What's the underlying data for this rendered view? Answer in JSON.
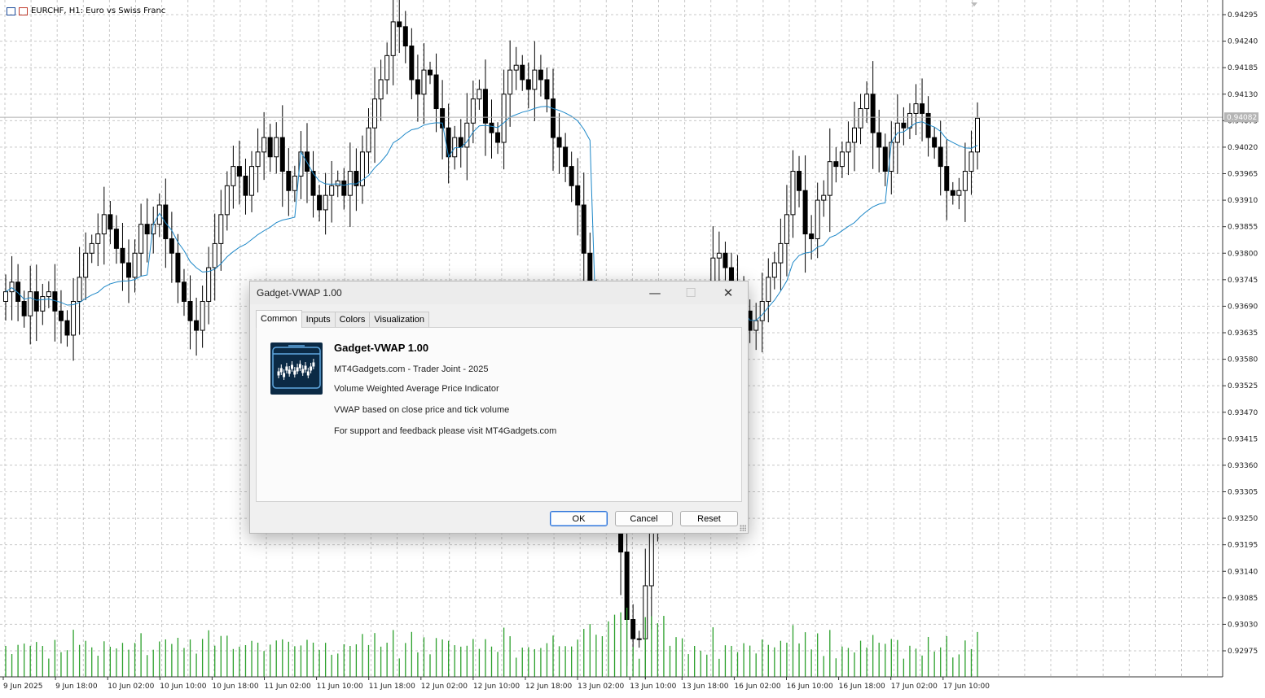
{
  "chart": {
    "symbol_title": "EURCHF, H1:  Euro vs Swiss Franc",
    "current_price": "0.94082",
    "price_ticks": [
      "0.94295",
      "0.94240",
      "0.94185",
      "0.94130",
      "0.94075",
      "0.94020",
      "0.93965",
      "0.93910",
      "0.93855",
      "0.93800",
      "0.93745",
      "0.93690",
      "0.93635",
      "0.93580",
      "0.93525",
      "0.93470",
      "0.93415",
      "0.93360",
      "0.93305",
      "0.93250",
      "0.93195",
      "0.93140",
      "0.93085",
      "0.93030",
      "0.92975"
    ],
    "time_ticks": [
      "9 Jun 2025",
      "9 Jun 18:00",
      "10 Jun 02:00",
      "10 Jun 10:00",
      "10 Jun 18:00",
      "11 Jun 02:00",
      "11 Jun 10:00",
      "11 Jun 18:00",
      "12 Jun 02:00",
      "12 Jun 10:00",
      "12 Jun 18:00",
      "13 Jun 02:00",
      "13 Jun 10:00",
      "13 Jun 18:00",
      "16 Jun 02:00",
      "16 Jun 10:00",
      "16 Jun 18:00",
      "17 Jun 02:00",
      "17 Jun 10:00"
    ],
    "colors": {
      "grid": "#c8c8c8",
      "vwap": "#1e88c8",
      "volume": "#2ca02c",
      "candle": "#000000",
      "axis_border": "#333333"
    },
    "price_range": [
      0.9292,
      0.9432
    ]
  },
  "chart_data": {
    "type": "candlestick",
    "instrument": "EURCHF",
    "timeframe": "H1",
    "close": [
      0.9372,
      0.9374,
      0.937,
      0.9367,
      0.9372,
      0.9368,
      0.9371,
      0.9372,
      0.9368,
      0.9366,
      0.9363,
      0.937,
      0.9375,
      0.938,
      0.9382,
      0.9384,
      0.9388,
      0.9385,
      0.9381,
      0.9378,
      0.9375,
      0.938,
      0.9386,
      0.9384,
      0.9386,
      0.939,
      0.9383,
      0.938,
      0.9374,
      0.937,
      0.9366,
      0.9364,
      0.937,
      0.9377,
      0.9382,
      0.9388,
      0.9394,
      0.9398,
      0.9396,
      0.9392,
      0.9398,
      0.9401,
      0.9404,
      0.94,
      0.9404,
      0.9397,
      0.9393,
      0.9396,
      0.9401,
      0.9397,
      0.9392,
      0.9389,
      0.9392,
      0.9394,
      0.9395,
      0.9392,
      0.9397,
      0.9394,
      0.9401,
      0.9406,
      0.9412,
      0.9416,
      0.9421,
      0.9428,
      0.9427,
      0.9423,
      0.9416,
      0.9413,
      0.9418,
      0.9417,
      0.941,
      0.9406,
      0.94,
      0.9404,
      0.9402,
      0.9407,
      0.9412,
      0.9414,
      0.9407,
      0.9405,
      0.9403,
      0.9413,
      0.9418,
      0.9419,
      0.9416,
      0.9414,
      0.9418,
      0.9416,
      0.9412,
      0.9404,
      0.9402,
      0.9398,
      0.9394,
      0.939,
      0.938,
      0.937,
      0.9364,
      0.9356,
      0.9346,
      0.9333,
      0.9318,
      0.9304,
      0.93,
      0.93,
      0.9311,
      0.9325,
      0.9335,
      0.9347,
      0.9352,
      0.9357,
      0.9363,
      0.9365,
      0.9367,
      0.937,
      0.9371,
      0.9379,
      0.938,
      0.9377,
      0.9374,
      0.9371,
      0.9368,
      0.9364,
      0.9366,
      0.937,
      0.9375,
      0.9378,
      0.9382,
      0.9388,
      0.9397,
      0.9393,
      0.9384,
      0.9383,
      0.9391,
      0.9392,
      0.9399,
      0.9398,
      0.9401,
      0.9403,
      0.9406,
      0.941,
      0.9413,
      0.9405,
      0.9402,
      0.9397,
      0.9403,
      0.9407,
      0.9406,
      0.9409,
      0.9411,
      0.9409,
      0.9404,
      0.9402,
      0.9398,
      0.9393,
      0.9392,
      0.9393,
      0.9397,
      0.9401,
      0.9408
    ],
    "series": [
      {
        "name": "VWAP",
        "type": "line"
      },
      {
        "name": "Tick Volume",
        "type": "histogram"
      }
    ]
  },
  "dialog": {
    "title": "Gadget-VWAP 1.00",
    "controls": {
      "minimize": "—",
      "maximize": "☐",
      "close": "✕"
    },
    "tabs": [
      "Common",
      "Inputs",
      "Colors",
      "Visualization"
    ],
    "active_tab": "Common",
    "info": {
      "name": "Gadget-VWAP 1.00",
      "author": "MT4Gadgets.com - Trader Joint - 2025",
      "description": "Volume Weighted Average Price Indicator",
      "detail": "VWAP based on close price and tick volume",
      "support": "For support and feedback please visit MT4Gadgets.com"
    },
    "buttons": {
      "ok": "OK",
      "cancel": "Cancel",
      "reset": "Reset"
    }
  }
}
